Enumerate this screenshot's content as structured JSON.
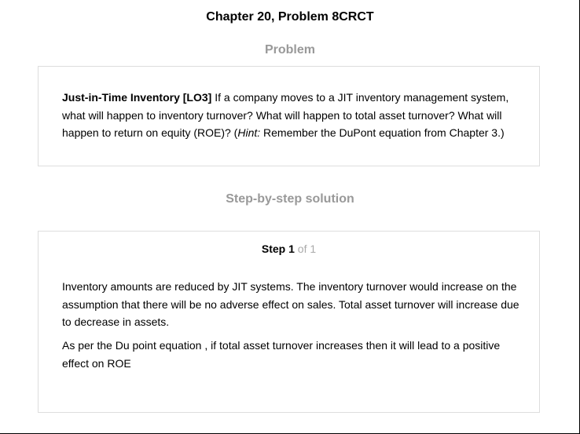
{
  "page": {
    "title": "Chapter 20, Problem 8CRCT"
  },
  "problem": {
    "heading": "Problem",
    "lead": "Just-in-Time Inventory [LO3]",
    "text_main": " If a company moves to a JIT inventory management system, what will happen to inventory turnover? What will happen to total asset turnover? What will happen to return on equity (ROE)? (",
    "hint_label": "Hint:",
    "hint_text": " Remember the DuPont equation from Chapter 3.)"
  },
  "solution": {
    "heading": "Step-by-step solution",
    "step_word": "Step",
    "step_number": "1",
    "step_total": " of 1",
    "paragraph_1": "Inventory amounts are reduced by JIT systems. The inventory turnover would increase on the assumption that there will be no adverse effect on sales. Total asset turnover will increase due to decrease in assets.",
    "paragraph_2": "As per the Du point equation , if total asset turnover increases then it will lead to a positive effect on ROE"
  }
}
